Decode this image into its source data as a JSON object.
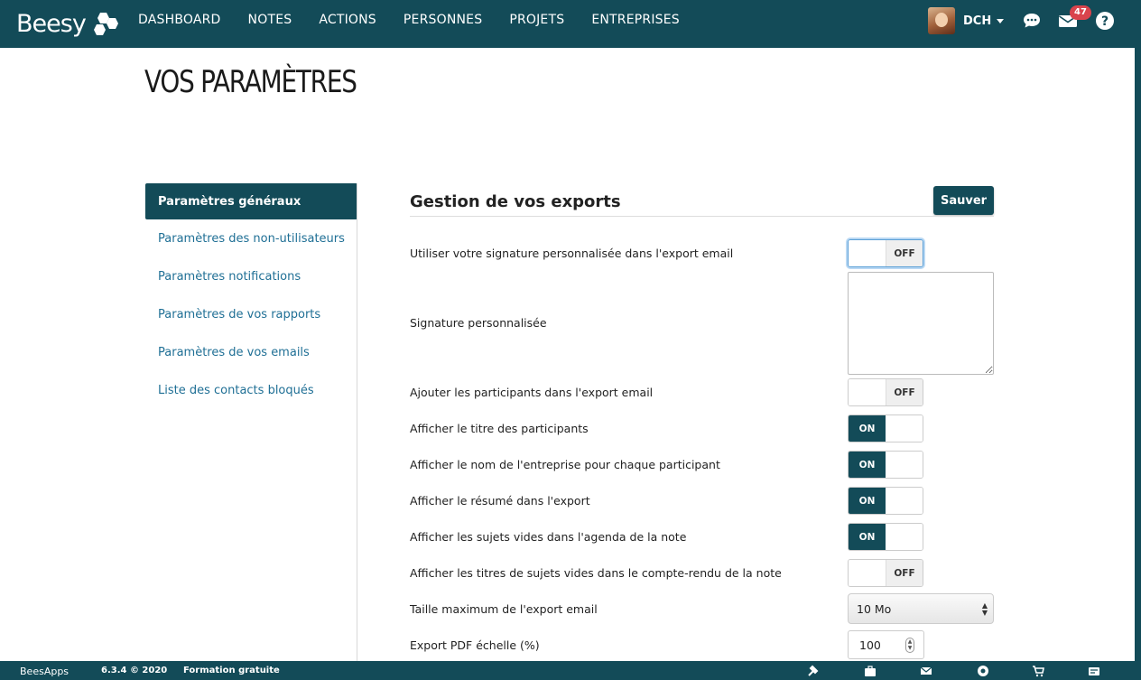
{
  "brand": {
    "logo_text": "Beesy"
  },
  "nav": {
    "items": [
      "DASHBOARD",
      "NOTES",
      "ACTIONS",
      "PERSONNES",
      "PROJETS",
      "ENTREPRISES"
    ]
  },
  "user": {
    "name": "DCH",
    "mail_count": "47"
  },
  "page": {
    "title": "VOS PARAMÈTRES"
  },
  "sidebar": {
    "items": [
      {
        "label": "Paramètres généraux",
        "active": true
      },
      {
        "label": "Paramètres des non-utilisateurs"
      },
      {
        "label": "Paramètres notifications"
      },
      {
        "label": "Paramètres de vos rapports"
      },
      {
        "label": "Paramètres de vos emails"
      },
      {
        "label": "Liste des contacts bloqués"
      }
    ]
  },
  "section": {
    "title": "Gestion de vos exports",
    "save_label": "Sauver"
  },
  "settings": {
    "signature_toggle": {
      "label": "Utiliser votre signature personnalisée dans l'export email",
      "state": "OFF"
    },
    "signature_text": {
      "label": "Signature personnalisée",
      "value": ""
    },
    "participants": {
      "label": "Ajouter les participants dans l'export email",
      "state": "OFF"
    },
    "titre_participants": {
      "label": "Afficher le titre des participants",
      "state": "ON"
    },
    "nom_entreprise": {
      "label": "Afficher le nom de l'entreprise pour chaque participant",
      "state": "ON"
    },
    "resume": {
      "label": "Afficher le résumé dans l'export",
      "state": "ON"
    },
    "sujets_vides": {
      "label": "Afficher les sujets vides dans l'agenda de la note",
      "state": "ON"
    },
    "titres_sujets_vides": {
      "label": "Afficher les titres de sujets vides dans le compte-rendu de la note",
      "state": "OFF"
    },
    "taille_max": {
      "label": "Taille maximum de l'export email",
      "value": "10 Mo"
    },
    "pdf_echelle": {
      "label": "Export PDF échelle (%)",
      "value": "100"
    }
  },
  "footer": {
    "brand": "BeesApps",
    "version": "6.3.4 © 2020",
    "training": "Formation gratuite"
  },
  "icons": {
    "chat": "chat-bubble-icon",
    "mail": "envelope-icon",
    "help": "question-icon",
    "footer": [
      "hammer-icon",
      "briefcase-icon",
      "envelope-icon",
      "support-icon",
      "cart-icon",
      "card-icon"
    ]
  },
  "colors": {
    "primary": "#134b58",
    "link": "#1f6f95",
    "badge": "#d9434c"
  }
}
